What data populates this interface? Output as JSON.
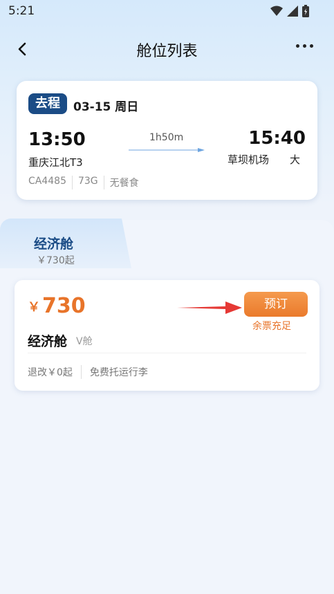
{
  "status_bar": {
    "time": "5:21"
  },
  "nav": {
    "title": "舱位列表"
  },
  "flight": {
    "trip_type": "去程",
    "date": "03-15 周日",
    "departure_time": "13:50",
    "arrival_time": "15:40",
    "duration": "1h50m",
    "departure_airport": "重庆江北T3",
    "arrival_airport": "草坝机场　　大",
    "flight_number": "CA4485",
    "aircraft": "73G",
    "meal": "无餐食"
  },
  "tabs": [
    {
      "name": "经济舱",
      "price": "￥730起"
    }
  ],
  "cabin": {
    "currency": "￥",
    "price": "730",
    "name": "经济舱",
    "class_code": "V舱",
    "book_label": "预订",
    "availability": "余票充足",
    "refund_policy": "退改￥0起",
    "baggage": "免费托运行李"
  },
  "colors": {
    "brand_blue": "#1b4c86",
    "accent_orange": "#e8742a",
    "arrow_red": "#e53935"
  }
}
